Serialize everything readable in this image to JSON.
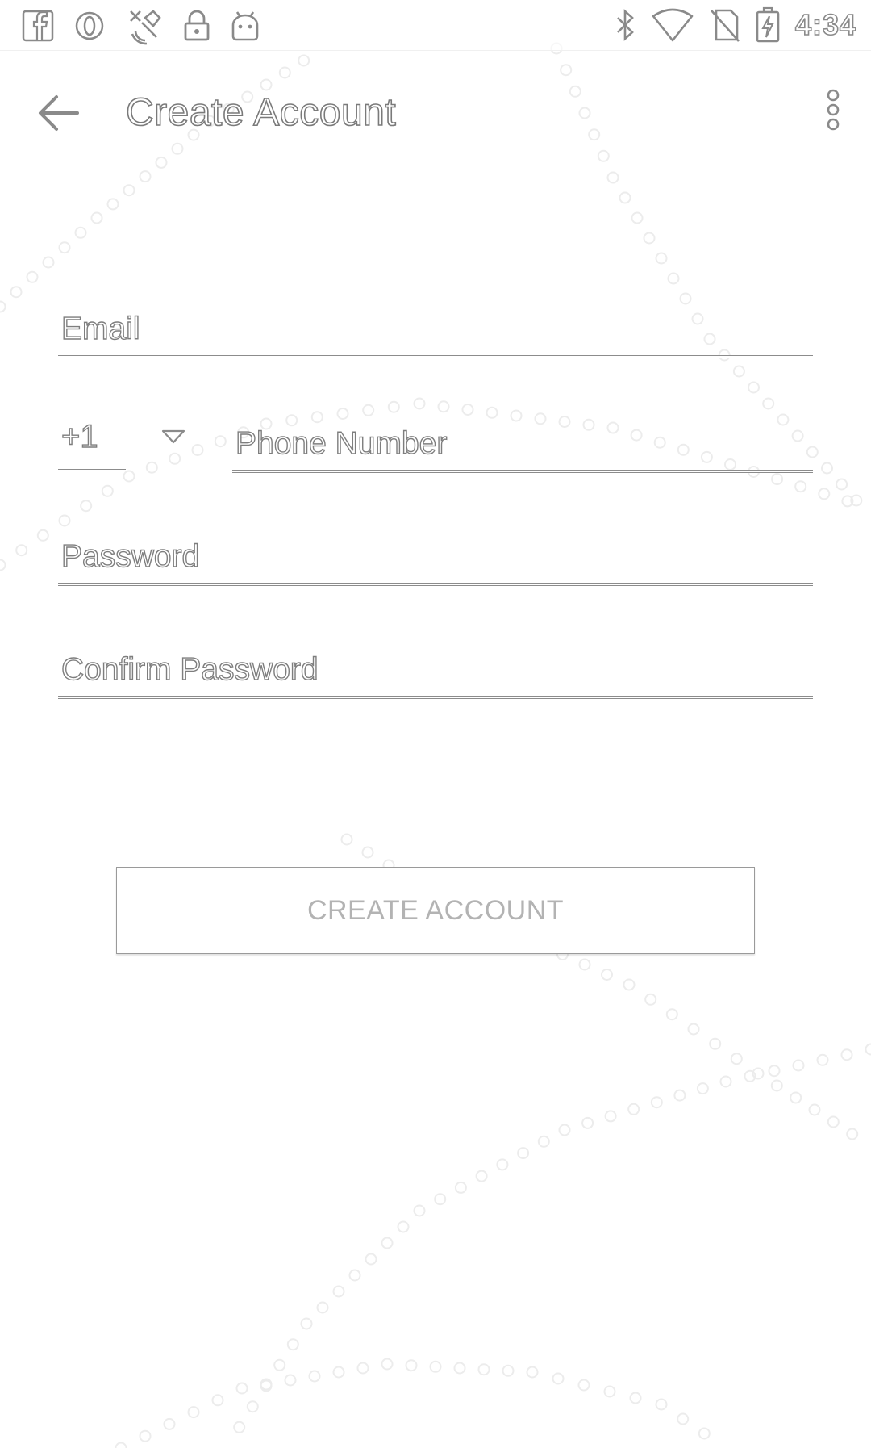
{
  "status_bar": {
    "left_icons": [
      "facebook-icon",
      "opera-icon",
      "satellite-icon",
      "lock-icon",
      "android-icon"
    ],
    "right_icons": [
      "bluetooth-icon",
      "wifi-icon",
      "no-sim-icon",
      "battery-charging-icon"
    ],
    "time": "4:34"
  },
  "app_bar": {
    "title": "Create Account",
    "back_icon": "arrow-back-icon",
    "menu_icon": "more-vert-icon"
  },
  "form": {
    "email_label": "Email",
    "country_code": "+1",
    "country_dropdown_icon": "triangle-down-icon",
    "phone_label": "Phone Number",
    "password_label": "Password",
    "confirm_password_label": "Confirm Password"
  },
  "actions": {
    "create_account_label": "CREATE ACCOUNT"
  }
}
